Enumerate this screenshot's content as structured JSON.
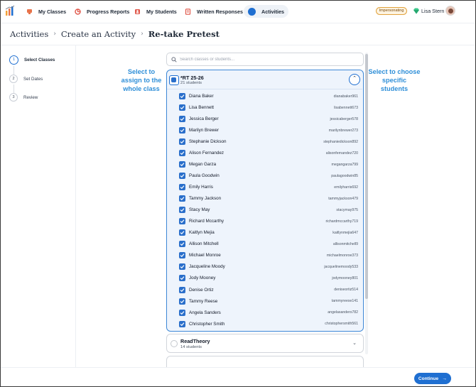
{
  "nav": {
    "items": [
      {
        "label": "My Classes",
        "color": "#e8734a"
      },
      {
        "label": "Progress Reports",
        "color": "#e0584b"
      },
      {
        "label": "My Students",
        "color": "#e0584b"
      },
      {
        "label": "Written Responses",
        "color": "#e0584b"
      },
      {
        "label": "Activities",
        "color": "#1f6fd1",
        "active": true
      }
    ],
    "impersonating_label": "Impersonating",
    "user_name": "Lisa Stern"
  },
  "breadcrumb": {
    "items": [
      "Activities",
      "Create an Activity",
      "Re-take Pretest"
    ],
    "separator": "›"
  },
  "steps": [
    {
      "num": "1",
      "label": "Select Classes",
      "active": true
    },
    {
      "num": "2",
      "label": "Set Dates",
      "active": false
    },
    {
      "num": "3",
      "label": "Review",
      "active": false
    }
  ],
  "annotations": {
    "left": [
      "Select to",
      "assign to the",
      "whole class"
    ],
    "right": [
      "Select to choose",
      "specific",
      "students"
    ]
  },
  "search": {
    "placeholder": "Search classes or students...",
    "value": ""
  },
  "expanded_class": {
    "name": "*RT 25-26",
    "count": "21 students",
    "selected": true,
    "students": [
      {
        "name": "Diana Baker",
        "username": "dianabaker961"
      },
      {
        "name": "Lisa Bennett",
        "username": "lisabennett673"
      },
      {
        "name": "Jessica Berger",
        "username": "jessicaberger578"
      },
      {
        "name": "Marilyn Brewer",
        "username": "marilynbrewer273"
      },
      {
        "name": "Stephanie Dickson",
        "username": "stephaniedickson892"
      },
      {
        "name": "Alison Fernandez",
        "username": "alisonfernandez720"
      },
      {
        "name": "Megan Garza",
        "username": "megangarza799"
      },
      {
        "name": "Paula Goodwin",
        "username": "paulagoodwin85"
      },
      {
        "name": "Emily Harris",
        "username": "emilyharris692"
      },
      {
        "name": "Tammy Jackson",
        "username": "tammyjackson479"
      },
      {
        "name": "Stacy May",
        "username": "stacymay975"
      },
      {
        "name": "Richard Mccarthy",
        "username": "richardmccarthy719"
      },
      {
        "name": "Kaitlyn Mejia",
        "username": "kaitlynmejia647"
      },
      {
        "name": "Allison Mitchell",
        "username": "allisonmitchell9"
      },
      {
        "name": "Michael Monroe",
        "username": "michaelmonroe373"
      },
      {
        "name": "Jacqueline Moody",
        "username": "jacquelinemoody533"
      },
      {
        "name": "Jody Mooney",
        "username": "jodymooney801"
      },
      {
        "name": "Denise Ortiz",
        "username": "deniseortiz514"
      },
      {
        "name": "Tammy Reese",
        "username": "tammyreese141"
      },
      {
        "name": "Angela Sanders",
        "username": "angelasanders782"
      },
      {
        "name": "Christopher Smith",
        "username": "christophersmith561"
      }
    ]
  },
  "other_classes": [
    {
      "name": "ReadTheory",
      "count": "14 students"
    }
  ],
  "footer": {
    "continue_label": "Continue",
    "continue_arrow": "→"
  },
  "colors": {
    "accent": "#1f6fd1",
    "annotation": "#2f8fd8",
    "impersonating_border": "#e1a23c"
  }
}
